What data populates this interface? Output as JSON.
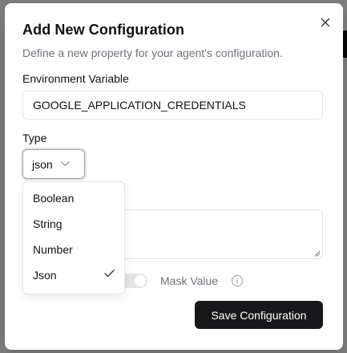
{
  "dialog": {
    "title": "Add New Configuration",
    "subtitle": "Define a new property for your agent's configuration."
  },
  "env_var": {
    "label": "Environment Variable",
    "value": "GOOGLE_APPLICATION_CREDENTIALS"
  },
  "type": {
    "label": "Type",
    "selected": "json",
    "options": [
      "Boolean",
      "String",
      "Number",
      "Json"
    ],
    "checked_option": "Json"
  },
  "mask": {
    "label": "Mask Value",
    "enabled": false
  },
  "actions": {
    "save_label": "Save Configuration"
  },
  "icons": {
    "close": "close-icon",
    "chevron": "chevron-down-icon",
    "check": "check-icon",
    "info": "info-icon"
  },
  "colors": {
    "primary_button": "#18181b",
    "muted_text": "#71717a",
    "border": "#e4e4e7"
  }
}
